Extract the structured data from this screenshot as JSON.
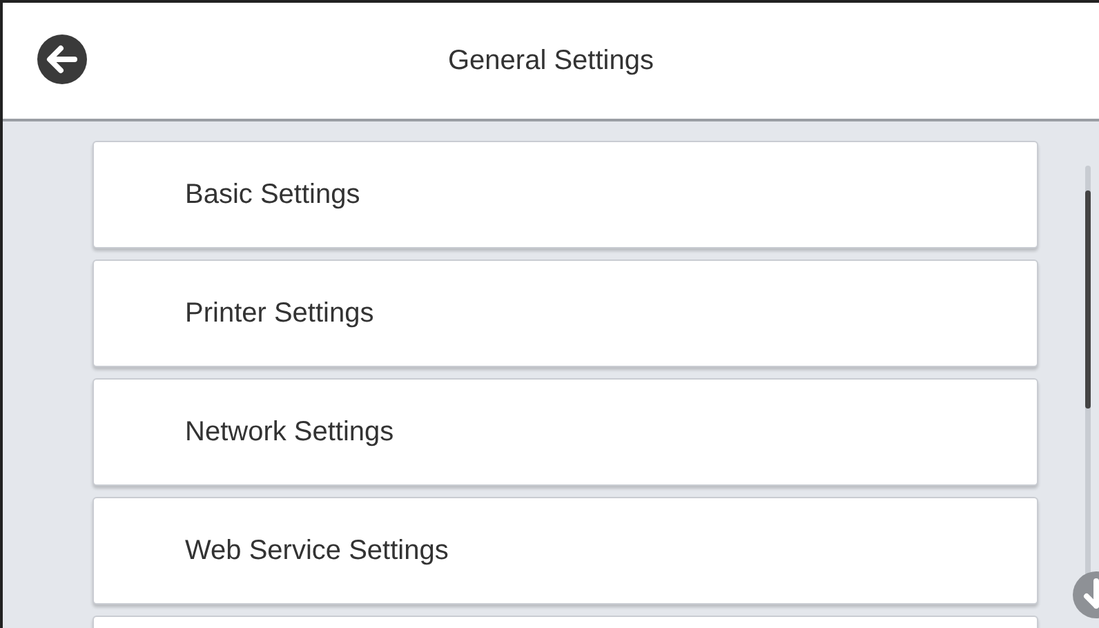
{
  "header": {
    "title": "General Settings"
  },
  "menu_items": [
    {
      "label": "Basic Settings"
    },
    {
      "label": "Printer Settings"
    },
    {
      "label": "Network Settings"
    },
    {
      "label": "Web Service Settings"
    }
  ]
}
